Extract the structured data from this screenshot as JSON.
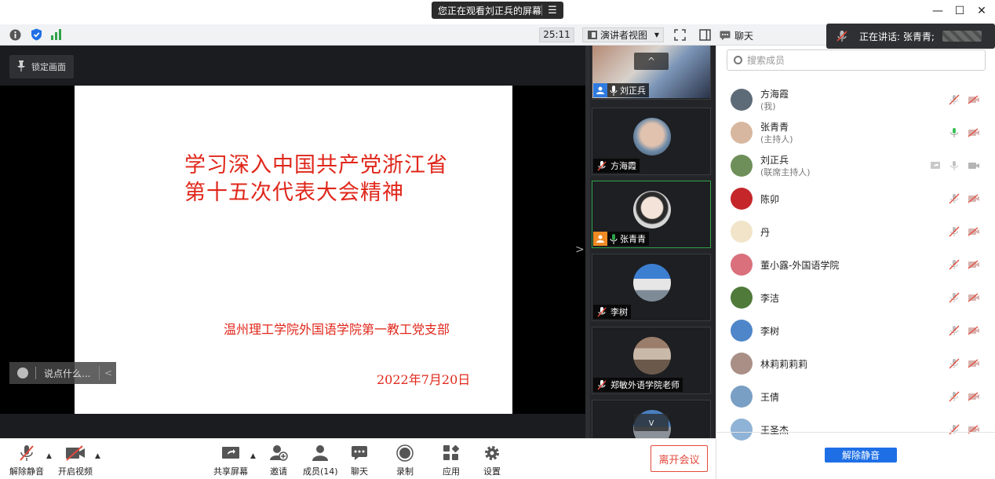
{
  "window": {
    "share_banner": "您正在观看刘正兵的屏幕",
    "menu_glyph": "☰",
    "controls": {
      "minimize": "—",
      "maximize": "☐",
      "close": "✕"
    }
  },
  "toolbar": {
    "timer": "25:11",
    "view_label": "演讲者视图",
    "chat_label": "聊天"
  },
  "speaking": {
    "text": "正在讲话: 张青青;"
  },
  "stage": {
    "lock_label": "锁定画面",
    "slide": {
      "title_line1": "学习深入中国共产党浙江省",
      "title_line2": "第十五次代表大会精神",
      "org": "温州理工学院外国语学院第一教工党支部",
      "date": "2022年7月20日"
    },
    "say_placeholder": "说点什么..."
  },
  "gallery": [
    {
      "name": "刘正兵",
      "badge": "blue",
      "mic": "on"
    },
    {
      "name": "方海霞",
      "badge": "none",
      "mic": "muted"
    },
    {
      "name": "张青青",
      "badge": "orange",
      "mic": "on",
      "active": true
    },
    {
      "name": "李树",
      "badge": "none",
      "mic": "muted"
    },
    {
      "name": "郑敏外语学院老师",
      "badge": "none",
      "mic": "muted"
    },
    {
      "name": "",
      "badge": "none",
      "mic": "none"
    }
  ],
  "bottom": {
    "unmute": "解除静音",
    "video": "开启视频",
    "share": "共享屏幕",
    "invite": "邀请",
    "members": "成员(14)",
    "chat": "聊天",
    "record": "录制",
    "apps": "应用",
    "settings": "设置",
    "leave": "离开会议"
  },
  "panel": {
    "search_placeholder": "搜索成员",
    "members": [
      {
        "name": "方海霞",
        "role": "(我)",
        "mic": "muted",
        "video": "off",
        "avatar_color": "#5d6b78"
      },
      {
        "name": "张青青",
        "role": "(主持人)",
        "mic": "active",
        "video": "off",
        "avatar_color": "#d8b7a0"
      },
      {
        "name": "刘正兵",
        "role": "(联席主持人)",
        "mic": "gray",
        "video": "gray",
        "share": true,
        "avatar_color": "#6f8f5a"
      },
      {
        "name": "陈卯",
        "role": "",
        "mic": "muted",
        "video": "off",
        "avatar_color": "#c4262a"
      },
      {
        "name": "丹",
        "role": "",
        "mic": "muted",
        "video": "off",
        "avatar_color": "#f1e4c8"
      },
      {
        "name": "董小露-外国语学院",
        "role": "",
        "mic": "muted",
        "video": "off",
        "avatar_color": "#d9707c"
      },
      {
        "name": "李洁",
        "role": "",
        "mic": "muted",
        "video": "off",
        "avatar_color": "#4f7a3a"
      },
      {
        "name": "李树",
        "role": "",
        "mic": "muted",
        "video": "off",
        "avatar_color": "#4e86c9"
      },
      {
        "name": "林莉莉莉莉",
        "role": "",
        "mic": "muted",
        "video": "off",
        "avatar_color": "#a98f86"
      },
      {
        "name": "王倩",
        "role": "",
        "mic": "muted",
        "video": "off",
        "avatar_color": "#7a9fc4"
      },
      {
        "name": "王圣杰",
        "role": "",
        "mic": "muted",
        "video": "off",
        "avatar_color": "#8fb3d6"
      }
    ],
    "unmute_all": "解除静音"
  },
  "colors": {
    "accent_blue": "#1e6fe6",
    "muted_red": "#e24a3b",
    "active_green": "#2ea24a",
    "slide_red": "#e0271b"
  }
}
